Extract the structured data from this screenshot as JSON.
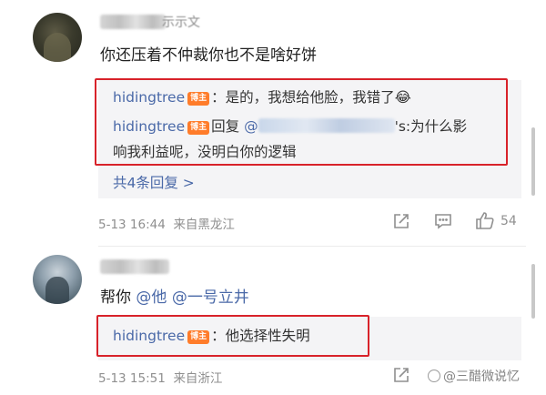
{
  "comments": [
    {
      "text": "你还压着不仲裁你也不是啥好饼",
      "replies": [
        {
          "user": "hidingtree",
          "badge": "博主",
          "text": "：是的，我想给他脸，我错了😂"
        },
        {
          "user": "hidingtree",
          "badge": "博主",
          "reply_word": "回复",
          "mention": "@",
          "text_line1": "'s:为什么影",
          "text_line2": "响我利益呢，没明白你的逻辑"
        }
      ],
      "more_replies": "共4条回复 >",
      "time": "5-13 16:44",
      "location": "来自黑龙江",
      "likes": "54"
    },
    {
      "text_prefix": "帮你",
      "mentions": [
        "@他",
        "@一号立井"
      ],
      "replies": [
        {
          "user": "hidingtree",
          "badge": "博主",
          "text": "：他选择性失明"
        }
      ],
      "time": "5-13 15:51",
      "location": "来自浙江"
    }
  ],
  "watermark": "@三醋微说忆",
  "colors": {
    "link": "#4a69a8",
    "badge": "#ff7c2a",
    "highlight_frame": "#d8222a"
  }
}
